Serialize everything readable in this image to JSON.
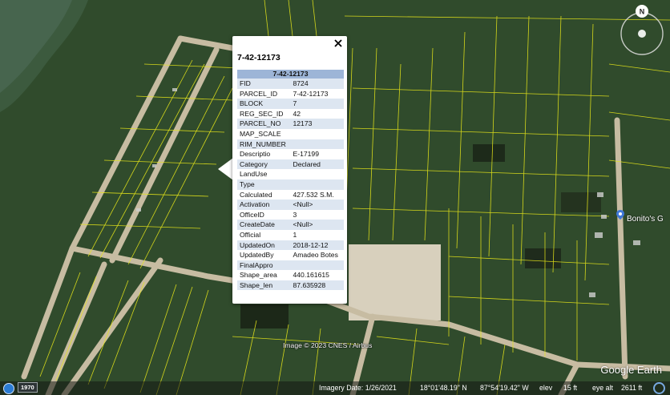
{
  "popup": {
    "title": "7-42-12173",
    "table_header": "7-42-12173",
    "rows": [
      {
        "key": "FID",
        "value": "8724"
      },
      {
        "key": "PARCEL_ID",
        "value": "7-42-12173"
      },
      {
        "key": "BLOCK",
        "value": "7"
      },
      {
        "key": "REG_SEC_ID",
        "value": "42"
      },
      {
        "key": "PARCEL_NO",
        "value": "12173"
      },
      {
        "key": "MAP_SCALE",
        "value": ""
      },
      {
        "key": "RIM_NUMBER",
        "value": ""
      },
      {
        "key": "Descriptio",
        "value": "E-17199"
      },
      {
        "key": "Category",
        "value": "Declared"
      },
      {
        "key": "LandUse",
        "value": ""
      },
      {
        "key": "Type",
        "value": ""
      },
      {
        "key": "Calculated",
        "value": "427.532 S.M."
      },
      {
        "key": "Activation",
        "value": "<Null>"
      },
      {
        "key": "OfficeID",
        "value": "3"
      },
      {
        "key": "CreateDate",
        "value": "<Null>"
      },
      {
        "key": "Official",
        "value": "1"
      },
      {
        "key": "UpdatedOn",
        "value": "2018-12-12"
      },
      {
        "key": "UpdatedBy",
        "value": "Amadeo Botes"
      },
      {
        "key": "FinalAppro",
        "value": ""
      },
      {
        "key": "Shape_area",
        "value": "440.161615"
      },
      {
        "key": "Shape_len",
        "value": "87.635928"
      }
    ],
    "close_glyph": "×"
  },
  "map": {
    "attribution": "Image © 2023 CNES / Airbus",
    "brand": "Google Earth",
    "poi_label": "Bonito's G",
    "compass_label": "N"
  },
  "statusbar": {
    "historical_year": "1970",
    "imagery_date": "Imagery Date: 1/26/2021",
    "latitude": "18°01'48.19\" N",
    "longitude": "87°54'19.42\" W",
    "elev_label": "elev",
    "elev_value": "15 ft",
    "eye_alt_label": "eye alt",
    "eye_alt_value": "2611 ft"
  },
  "colors": {
    "vegetation": "#2f4a2a",
    "road": "#c9bfa6",
    "parcel_lines": "#e8e817",
    "table_header": "#9db5d7",
    "row_alt": "#dde6f1"
  },
  "icons": [
    "close-icon",
    "compass-icon",
    "poi-pin-icon",
    "historical-imagery-icon",
    "streaming-icon"
  ]
}
